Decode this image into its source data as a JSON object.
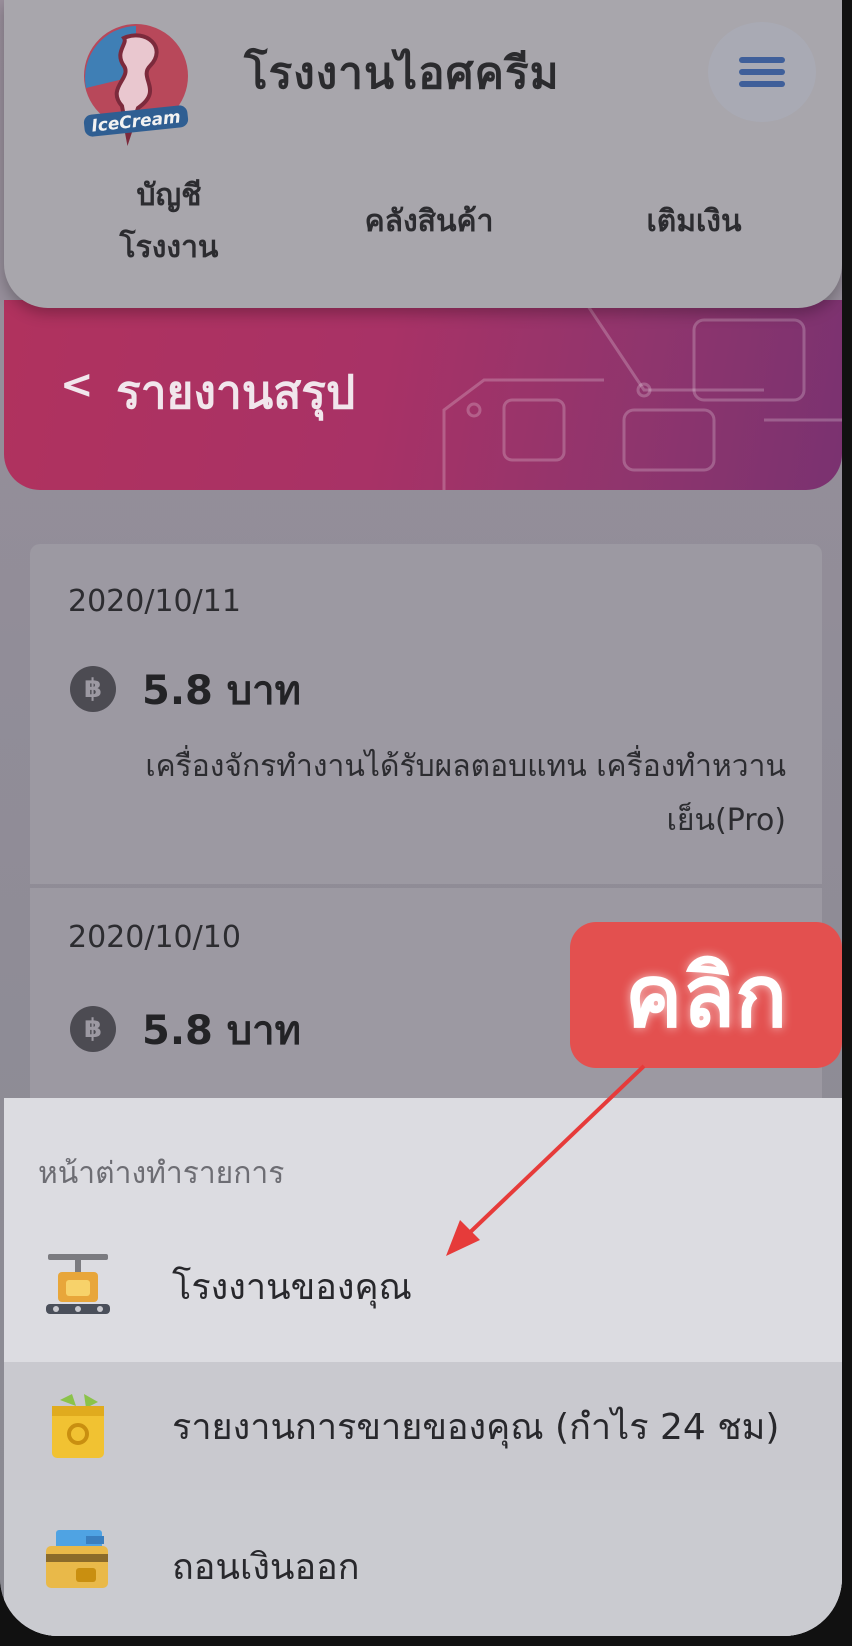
{
  "header": {
    "logo_text": "IceCream",
    "title": "โรงงานไอศครีม",
    "nav": [
      {
        "label_line1": "บัญชี",
        "label_line2": "โรงงาน"
      },
      {
        "label": "คลังสินค้า"
      },
      {
        "label": "เติมเงิน"
      }
    ]
  },
  "banner": {
    "back_glyph": "<",
    "title": "รายงานสรุป"
  },
  "records": [
    {
      "date": "2020/10/11",
      "coin_glyph": "฿",
      "amount": "5.8 บาท",
      "description_line1": "เครื่องจักรทำงานได้รับผลตอบแทน เครื่องทำหวาน",
      "description_line2": "เย็น(Pro)"
    },
    {
      "date": "2020/10/10",
      "coin_glyph": "฿",
      "amount": "5.8 บาท"
    }
  ],
  "sheet": {
    "title": "หน้าต่างทำรายการ",
    "items": [
      {
        "label": "โรงงานของคุณ",
        "icon": "factory-machine-icon"
      },
      {
        "label": "รายงานการขายของคุณ (กำไร 24 ชม)",
        "icon": "shopping-bag-icon"
      },
      {
        "label": "ถอนเงินออก",
        "icon": "wallet-cash-icon"
      }
    ]
  },
  "annotation": {
    "callout_text": "คลิก",
    "callout_color": "#e3504f"
  },
  "colors": {
    "banner": "#b0325e",
    "menu_icon": "#3f5f9a"
  }
}
